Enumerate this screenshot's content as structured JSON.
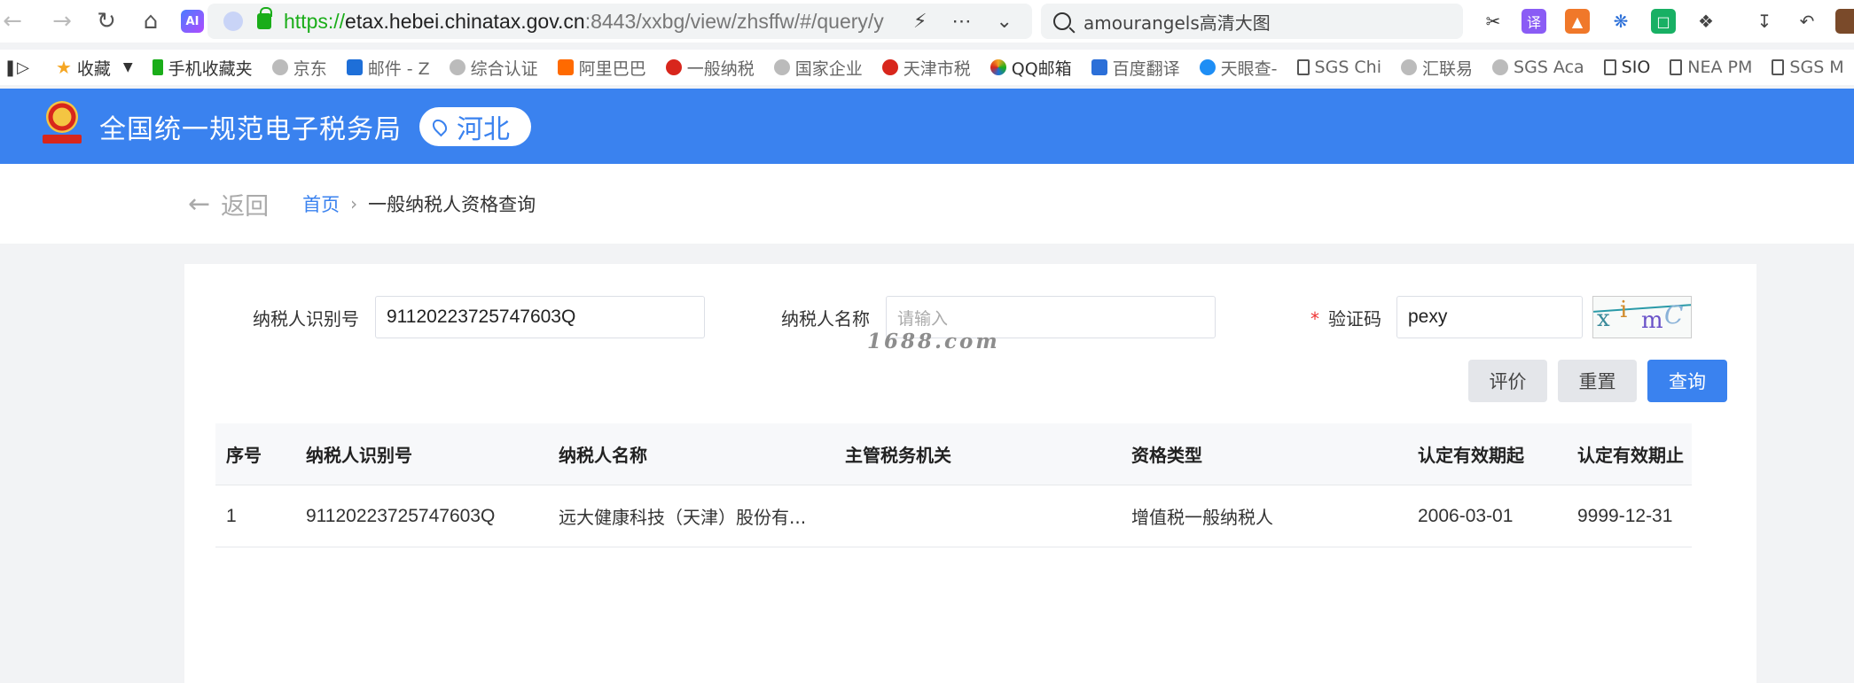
{
  "browser": {
    "url_scheme": "https://",
    "url_host": "etax.hebei.chinatax.gov.cn",
    "url_rest": ":8443/xxbg/view/zhsffw/#/query/y",
    "search_text": "amourangels高清大图",
    "ai_label": "AI",
    "ext_translate": "译"
  },
  "bookmarks": [
    {
      "label": "收藏",
      "icon": "star-icon"
    },
    {
      "label": "手机收藏夹",
      "icon": "phone-icon"
    },
    {
      "label": "京东",
      "icon": "globe-icon"
    },
    {
      "label": "邮件 - Z",
      "icon": "outlook-icon"
    },
    {
      "label": "综合认证",
      "icon": "globe-icon"
    },
    {
      "label": "阿里巴巴",
      "icon": "alibaba-icon"
    },
    {
      "label": "一般纳税",
      "icon": "tax-emblem-icon"
    },
    {
      "label": "国家企业",
      "icon": "globe-icon"
    },
    {
      "label": "天津市税",
      "icon": "tax-emblem-icon"
    },
    {
      "label": "QQ邮箱",
      "icon": "qq-mail-icon"
    },
    {
      "label": "百度翻译",
      "icon": "baidu-translate-icon"
    },
    {
      "label": "天眼查-",
      "icon": "tianyancha-icon"
    },
    {
      "label": "SGS Chi",
      "icon": "document-icon"
    },
    {
      "label": "汇联易",
      "icon": "globe-icon"
    },
    {
      "label": "SGS Aca",
      "icon": "globe-icon"
    },
    {
      "label": "SIO",
      "icon": "document-icon"
    },
    {
      "label": "NEA PM",
      "icon": "document-icon"
    },
    {
      "label": "SGS M",
      "icon": "document-icon"
    }
  ],
  "header": {
    "title": "全国统一规范电子税务局",
    "region": "河北"
  },
  "breadcrumb": {
    "back": "返回",
    "home": "首页",
    "current": "一般纳税人资格查询"
  },
  "form": {
    "taxpayer_id_label": "纳税人识别号",
    "taxpayer_id_value": "91120223725747603Q",
    "taxpayer_name_label": "纳税人名称",
    "taxpayer_name_placeholder": "请输入",
    "captcha_required_mark": "*",
    "captcha_label": "验证码",
    "captcha_value": "pexy",
    "captcha_chars": [
      "x",
      "i",
      "m",
      "C"
    ],
    "watermark": "1688.com"
  },
  "buttons": {
    "evaluate": "评价",
    "reset": "重置",
    "query": "查询"
  },
  "table": {
    "headers": [
      "序号",
      "纳税人识别号",
      "纳税人名称",
      "主管税务机关",
      "资格类型",
      "认定有效期起",
      "认定有效期止"
    ],
    "rows": [
      [
        "1",
        "91120223725747603Q",
        "远大健康科技（天津）股份有...",
        "",
        "增值税一般纳税人",
        "2006-03-01",
        "9999-12-31"
      ]
    ]
  },
  "colors": {
    "brand_blue": "#3a82ef",
    "required_red": "#e33333"
  }
}
